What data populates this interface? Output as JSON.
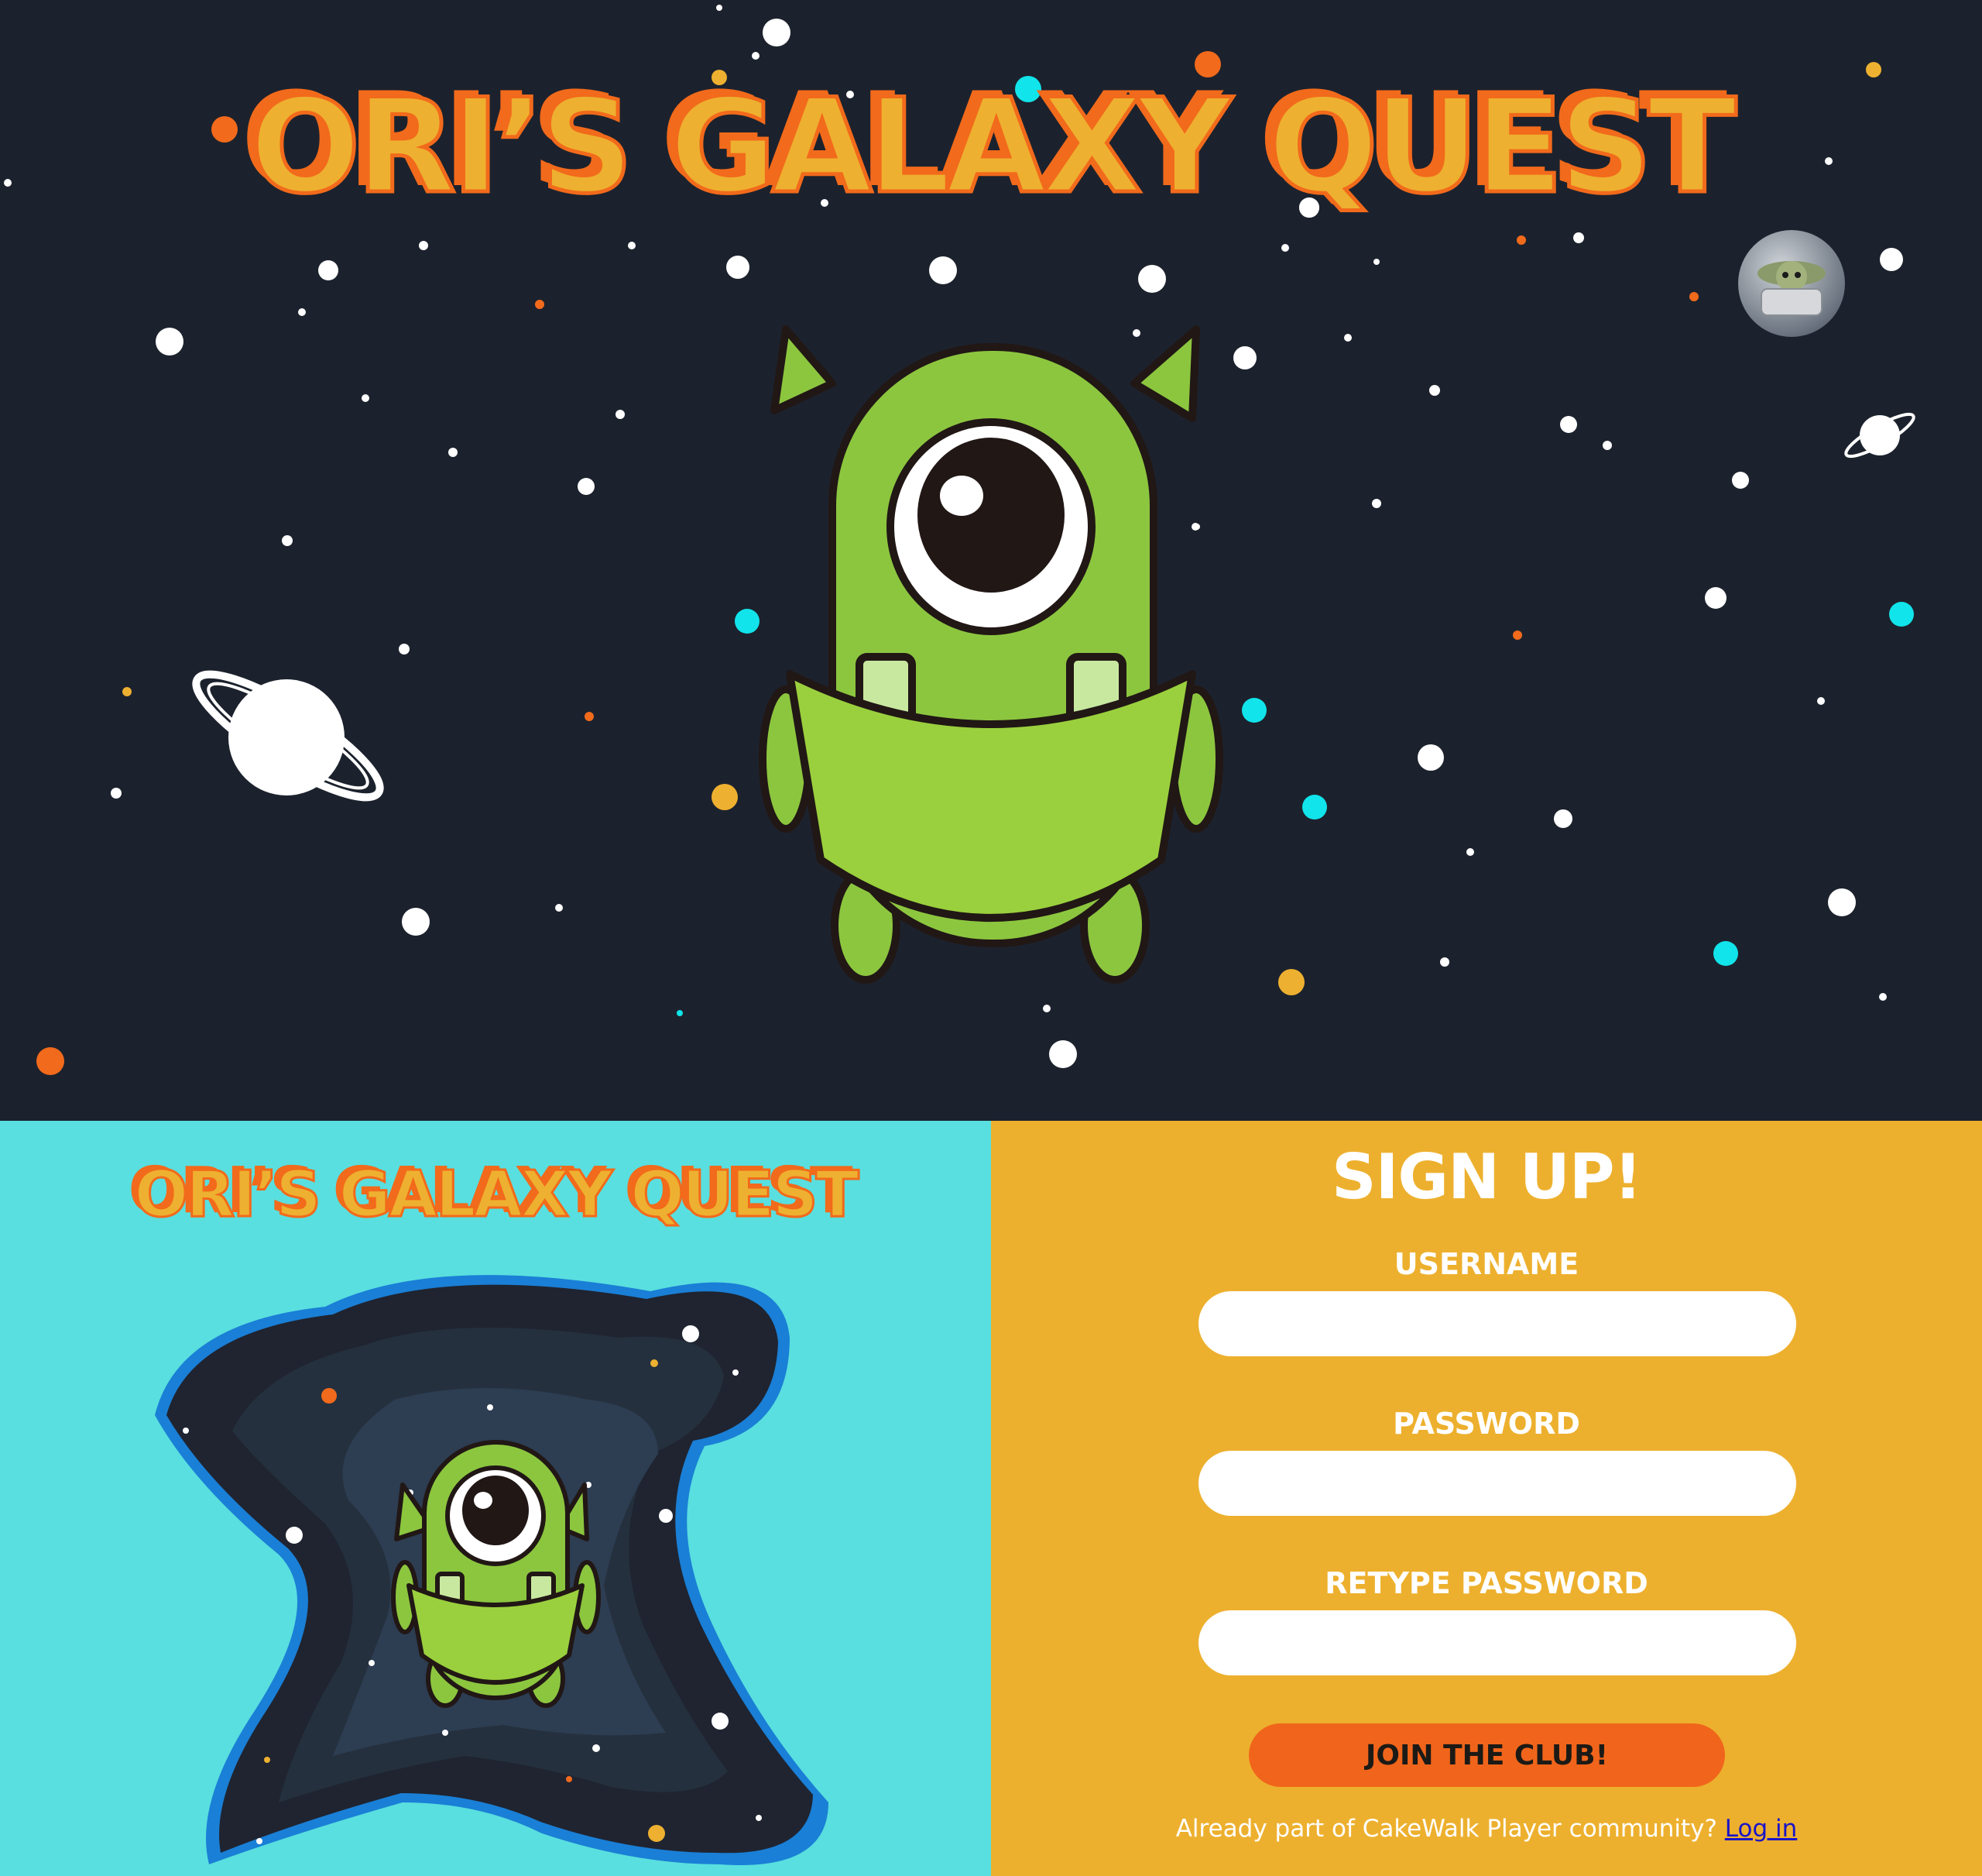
{
  "hero": {
    "title": "ORI’S GALAXY QUEST",
    "mascot_icon": "one-eyed-green-alien",
    "avatar_icon": "baby-alien-in-pod"
  },
  "brand_panel": {
    "title": "ORI’S GALAXY QUEST",
    "illustration_icon": "alien-in-galaxy-blob"
  },
  "signup": {
    "title": "SIGN UP!",
    "username_label": "USERNAME",
    "username_value": "",
    "password_label": "PASSWORD",
    "password_value": "",
    "retype_label": "RETYPE PASSWORD",
    "retype_value": "",
    "join_label": "JOIN THE CLUB!",
    "already_text": "Already part of CakeWalk Player community?",
    "login_link": "Log in"
  },
  "colors": {
    "space": "#1c222d",
    "cyan_panel": "#59dfdf",
    "orange_panel": "#edb02e",
    "accent_orange": "#f26a1b",
    "title_yellow": "#eeb030",
    "alien_green": "#8cc63f",
    "link_blue": "#1a14c8"
  }
}
